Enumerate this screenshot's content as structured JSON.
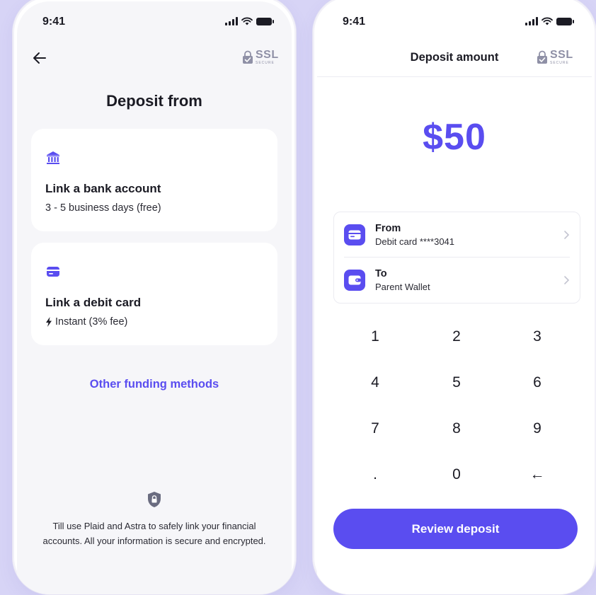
{
  "status_bar": {
    "time": "9:41"
  },
  "ssl_badge": {
    "label": "SSL",
    "sub": "SECURE"
  },
  "left_screen": {
    "title": "Deposit from",
    "options": [
      {
        "title": "Link a bank account",
        "subtitle": "3 - 5 business days (free)",
        "icon": "bank-icon"
      },
      {
        "title": "Link a debit card",
        "subtitle": "Instant (3% fee)",
        "icon": "debit-card-icon",
        "prefix_icon": "lightning-icon"
      }
    ],
    "other_methods_link": "Other funding methods",
    "disclaimer": "Till use Plaid and Astra to safely link your financial accounts. All your information is secure and encrypted."
  },
  "right_screen": {
    "title": "Deposit amount",
    "amount": "$50",
    "from": {
      "label": "From",
      "value": "Debit card ****3041"
    },
    "to": {
      "label": "To",
      "value": "Parent Wallet"
    },
    "keypad": [
      "1",
      "2",
      "3",
      "4",
      "5",
      "6",
      "7",
      "8",
      "9",
      ".",
      "0",
      "←"
    ],
    "review_button": "Review deposit"
  },
  "colors": {
    "accent": "#5a4df0",
    "background": "#d7d4f6",
    "muted_icon": "#8f90a6",
    "text": "#1b1b24"
  }
}
